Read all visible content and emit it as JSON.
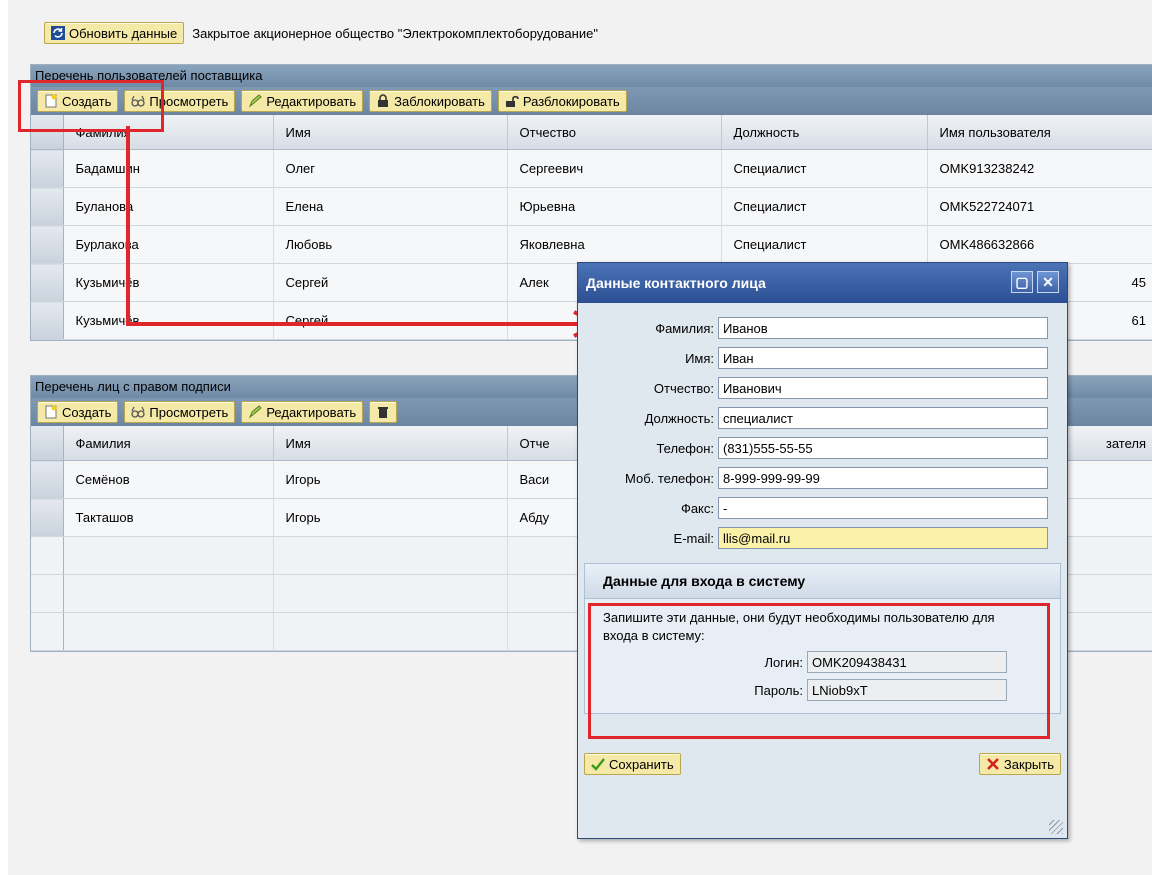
{
  "header": {
    "refresh_label": "Обновить данные",
    "company": "Закрытое акционерное общество \"Электрокомплектоборудование\""
  },
  "users_panel": {
    "title": "Перечень пользователей поставщика",
    "toolbar": {
      "create": "Создать",
      "view": "Просмотреть",
      "edit": "Редактировать",
      "lock": "Заблокировать",
      "unlock": "Разблокировать"
    },
    "columns": [
      "Фамилия",
      "Имя",
      "Отчество",
      "Должность",
      "Имя пользователя"
    ],
    "rows": [
      [
        "Бадамшин",
        "Олег",
        "Сергеевич",
        "Специалист",
        "OMK913238242"
      ],
      [
        "Буланова",
        "Елена",
        "Юрьевна",
        "Специалист",
        "OMK522724071"
      ],
      [
        "Бурлакова",
        "Любовь",
        "Яковлевна",
        "Специалист",
        "OMK486632866"
      ],
      [
        "Кузьмичёв",
        "Сергей",
        "Алек",
        "",
        "45"
      ],
      [
        "Кузьмичёв",
        "Сергей",
        "",
        "",
        "61"
      ]
    ]
  },
  "signers_panel": {
    "title": "Перечень лиц с правом подписи",
    "toolbar": {
      "create": "Создать",
      "view": "Просмотреть",
      "edit": "Редактировать"
    },
    "columns": [
      "Фамилия",
      "Имя",
      "Отче",
      "",
      "зателя"
    ],
    "rows": [
      [
        "Семёнов",
        "Игорь",
        "Васи",
        "",
        ""
      ],
      [
        "Такташов",
        "Игорь",
        "Абду",
        "",
        ""
      ]
    ]
  },
  "dialog": {
    "title": "Данные контактного лица",
    "fields": [
      {
        "label": "Фамилия:",
        "value": "Иванов"
      },
      {
        "label": "Имя:",
        "value": "Иван"
      },
      {
        "label": "Отчество:",
        "value": "Иванович"
      },
      {
        "label": "Должность:",
        "value": "специалист"
      },
      {
        "label": "Телефон:",
        "value": "(831)555-55-55"
      },
      {
        "label": "Моб. телефон:",
        "value": "8-999-999-99-99"
      },
      {
        "label": "Факс:",
        "value": "-"
      },
      {
        "label": "E-mail:",
        "value": "llis@mail.ru"
      }
    ],
    "login_section": {
      "title": "Данные для входа в систему",
      "note": "Запишите эти данные, они будут необходимы пользователю для входа в систему:",
      "login_label": "Логин:",
      "login_value": "OMK209438431",
      "password_label": "Пароль:",
      "password_value": "LNiob9xT"
    },
    "save_label": "Сохранить",
    "close_label": "Закрыть"
  },
  "colors": {
    "accent_red": "#e0252b",
    "button_yellow": "#f5e9a8",
    "title_blue": "#2c4f93",
    "highlight": "#fcf1a8"
  }
}
